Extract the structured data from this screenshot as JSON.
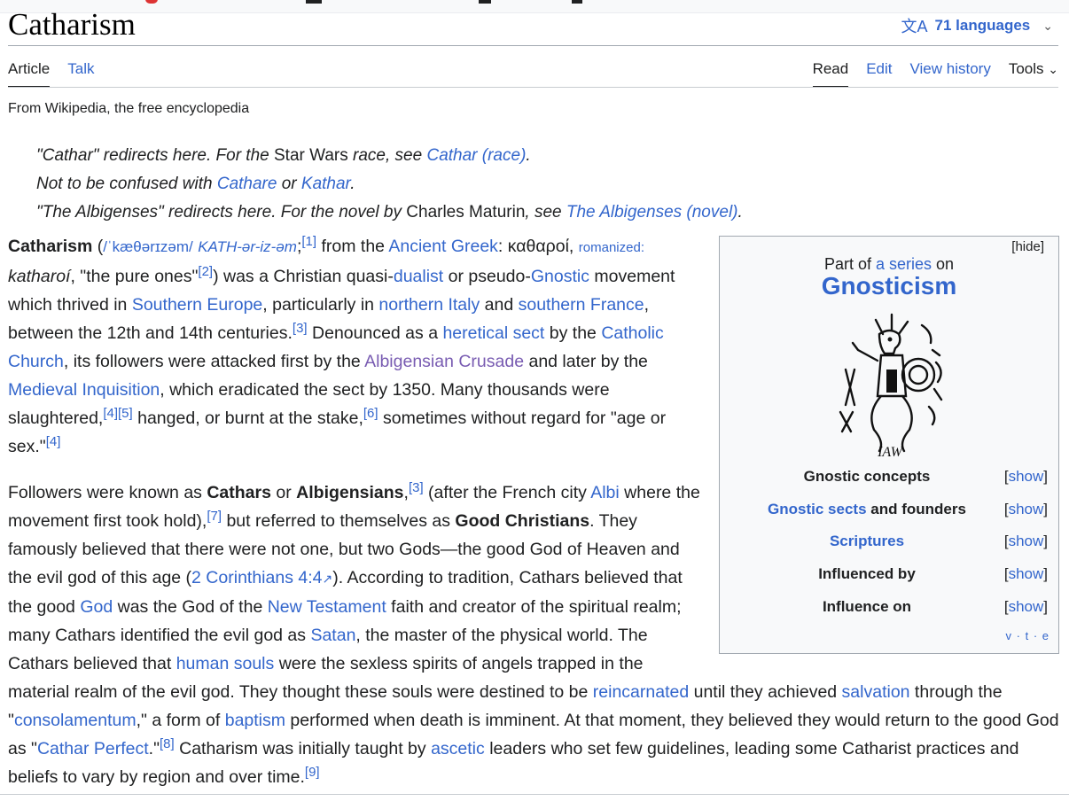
{
  "page": {
    "title": "Catharism",
    "languages": "71 languages",
    "tagline": "From Wikipedia, the free encyclopedia"
  },
  "tabs": {
    "left": [
      "Article",
      "Talk"
    ],
    "right": [
      "Read",
      "Edit",
      "View history",
      "Tools"
    ]
  },
  "hatnotes": {
    "line1_a": "\"Cathar\" redirects here. For the ",
    "line1_b": "Star Wars",
    "line1_c": " race, see ",
    "line1_link": "Cathar (race)",
    "line1_end": ".",
    "line2_a": "Not to be confused with ",
    "line2_link1": "Cathare",
    "line2_b": " or ",
    "line2_link2": "Kathar",
    "line2_end": ".",
    "line3_a": "\"The Albigenses\" redirects here. For the novel by ",
    "line3_b": "Charles Maturin",
    "line3_c": ", see ",
    "line3_link": "The Albigenses (novel)",
    "line3_end": "."
  },
  "infobox": {
    "hide": "[hide]",
    "part_of_a": "Part of ",
    "part_of_link": "a series",
    "part_of_b": " on",
    "series": "Gnosticism",
    "emblem_text": "IAW",
    "rows": [
      {
        "label": "Gnostic concepts",
        "link": "",
        "tail": "",
        "show": "[show]"
      },
      {
        "label": "",
        "link": "Gnostic sects",
        "tail": " and founders",
        "show": "[show]"
      },
      {
        "label": "",
        "link": "Scriptures",
        "tail": "",
        "show": "[show]"
      },
      {
        "label": "Influenced by",
        "link": "",
        "tail": "",
        "show": "[show]"
      },
      {
        "label": "Influence on",
        "link": "",
        "tail": "",
        "show": "[show]"
      }
    ],
    "vte": "v · t · e"
  },
  "p1": {
    "t0": "Catharism",
    "t1": " (",
    "ipa": "/ˈkæθərɪzəm/",
    "t2": " ",
    "resp": "KATH-ər-iz-əm",
    "t3": ";",
    "r1": "[1]",
    "t4": " from the ",
    "l1": "Ancient Greek",
    "t5": ": καθαροί, ",
    "l2": "romanized:",
    "t6": " katharoí",
    "t7": ", \"the pure ones\"",
    "r2": "[2]",
    "t8": ") was a Christian quasi-",
    "l3": "dualist",
    "t9": " or pseudo-",
    "l4": "Gnostic",
    "t10": " movement which thrived in ",
    "l5": "Southern Europe",
    "t11": ", particularly in ",
    "l6": "northern Italy",
    "t12": " and ",
    "l7": "southern France",
    "t13": ", between the 12th and 14th centuries.",
    "r3": "[3]",
    "t14": " Denounced as a ",
    "l8": "heretical sect",
    "t15": " by the ",
    "l9": "Catholic Church",
    "t16": ", its followers were attacked first by the ",
    "l10": "Albigensian Crusade",
    "t17": " and later by the ",
    "l11": "Medieval Inquisition",
    "t18": ", which eradicated the sect by 1350. Many thousands were slaughtered,",
    "r4": "[4]",
    "r5": "[5]",
    "t19": " hanged, or burnt at the stake,",
    "r6": "[6]",
    "t20": " sometimes without regard for \"age or sex.\"",
    "r7": "[4]"
  },
  "p2": {
    "t0": "Followers were known as ",
    "b1": "Cathars",
    "t1": " or ",
    "b2": "Albigensians",
    "t2": ",",
    "r1": "[3]",
    "t3": " (after the French city ",
    "l1": "Albi",
    "t4": " where the movement first took hold),",
    "r2": "[7]",
    "t5": " but referred to themselves as ",
    "b3": "Good Christians",
    "t6": ". They famously believed that there were not one, but two Gods—the good God of Heaven and the evil god of this age (",
    "l2": "2 Corinthians 4:4",
    "t7": "). According to tradition, Cathars believed that the good ",
    "l3": "God",
    "t8": " was the God of the ",
    "l4": "New Testament",
    "t9": " faith and creator of the spiritual realm; many Cathars identified the evil god as ",
    "l5": "Satan",
    "t10": ", the master of the physical world. The Cathars believed that ",
    "l6": "human souls",
    "t11": " were the sexless spirits of angels trapped in the material realm of the evil god. They thought these souls were destined to be ",
    "l7": "reincarnated",
    "t12": " until they achieved ",
    "l8": "salvation",
    "t13": " through the \"",
    "l9": "consolamentum",
    "t14": ",\" a form of ",
    "l10": "baptism",
    "t15": " performed when death is imminent. At that moment, they believed they would return to the good God as \"",
    "l11": "Cathar Perfect",
    "t16": ".\"",
    "r3": "[8]",
    "t17": " Catharism was initially taught by ",
    "l12": "ascetic",
    "t18": " leaders who set few guidelines, leading some Catharist practices and beliefs to vary by region and over time.",
    "r4": "[9]"
  }
}
